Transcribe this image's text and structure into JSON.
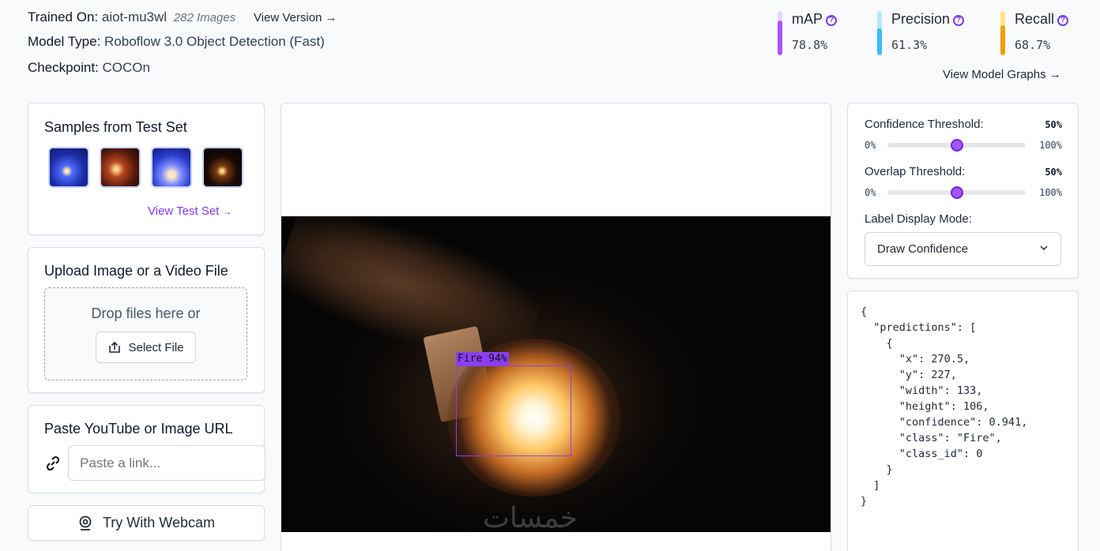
{
  "header": {
    "trained_on_label": "Trained On:",
    "trained_on_value": "aiot-mu3wl",
    "images_count": "282 Images",
    "view_version": "View Version",
    "model_type_label": "Model Type:",
    "model_type_value": "Roboflow 3.0 Object Detection (Fast)",
    "checkpoint_label": "Checkpoint:",
    "checkpoint_value": "COCOn",
    "view_model_graphs": "View Model Graphs"
  },
  "metrics": [
    {
      "name": "mAP",
      "value": "78.8%",
      "fraction": 0.788,
      "color": "#a855f7",
      "track_color": "#e9d5ff"
    },
    {
      "name": "Precision",
      "value": "61.3%",
      "fraction": 0.613,
      "color": "#38bdf8",
      "track_color": "#bae6fd"
    },
    {
      "name": "Recall",
      "value": "68.7%",
      "fraction": 0.687,
      "color": "#f59e0b",
      "track_color": "#fde68a"
    }
  ],
  "samples": {
    "title": "Samples from Test Set",
    "view_test_set": "View Test Set"
  },
  "upload": {
    "title": "Upload Image or a Video File",
    "drop_text": "Drop files here or",
    "select_file": "Select File"
  },
  "url": {
    "title": "Paste YouTube or Image URL",
    "placeholder": "Paste a link..."
  },
  "webcam": {
    "label": "Try With Webcam"
  },
  "preview": {
    "detection_label": "Fire 94%",
    "watermark": "خمسات"
  },
  "controls": {
    "confidence_label": "Confidence Threshold:",
    "confidence_value": "50%",
    "confidence_fraction": 0.5,
    "overlap_label": "Overlap Threshold:",
    "overlap_value": "50%",
    "overlap_fraction": 0.5,
    "min_label": "0%",
    "max_label": "100%",
    "label_mode_label": "Label Display Mode:",
    "label_mode_value": "Draw Confidence"
  },
  "output_json": "{\n  \"predictions\": [\n    {\n      \"x\": 270.5,\n      \"y\": 227,\n      \"width\": 133,\n      \"height\": 106,\n      \"confidence\": 0.941,\n      \"class\": \"Fire\",\n      \"class_id\": 0\n    }\n  ]\n}"
}
